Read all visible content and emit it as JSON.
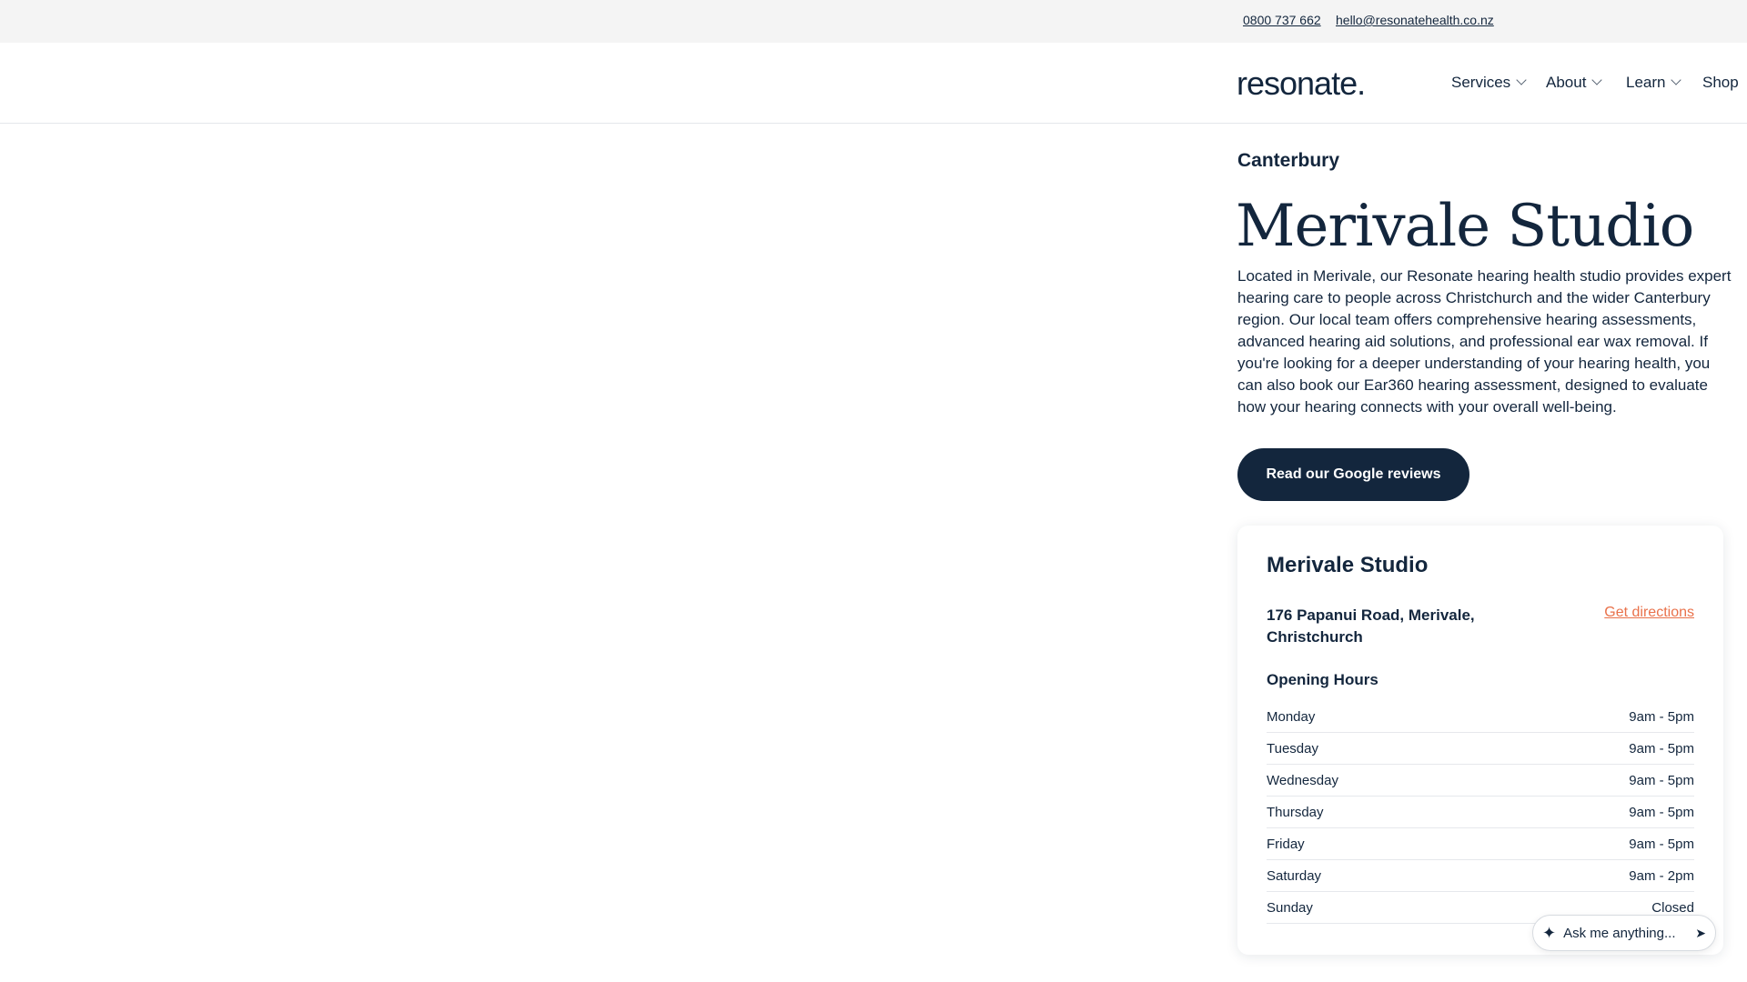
{
  "topbar": {
    "phone": "0800 737 662",
    "email": "hello@resonatehealth.co.nz"
  },
  "header": {
    "logo": "resonate.",
    "nav": [
      {
        "label": "Services"
      },
      {
        "label": "About"
      },
      {
        "label": "Learn"
      },
      {
        "label": "Shop"
      }
    ]
  },
  "main": {
    "region": "Canterbury",
    "title": "Merivale Studio",
    "intro": "Located in Merivale, our Resonate hearing health studio provides expert hearing care to people across Christchurch and the wider Canterbury region. Our local team offers comprehensive hearing assessments, advanced hearing aid solutions, and professional ear wax removal. If you're looking for a deeper understanding of your hearing health, you can also book our Ear360 hearing assessment, designed to evaluate how your hearing connects with your overall well-being.",
    "reviews_button": "Read our Google reviews"
  },
  "card": {
    "title": "Merivale Studio",
    "address": "176 Papanui Road, Merivale, Christchurch",
    "directions": "Get directions",
    "hours_title": "Opening Hours",
    "hours": [
      {
        "day": "Monday",
        "time": "9am - 5pm"
      },
      {
        "day": "Tuesday",
        "time": "9am - 5pm"
      },
      {
        "day": "Wednesday",
        "time": "9am - 5pm"
      },
      {
        "day": "Thursday",
        "time": "9am - 5pm"
      },
      {
        "day": "Friday",
        "time": "9am - 5pm"
      },
      {
        "day": "Saturday",
        "time": "9am - 2pm"
      },
      {
        "day": "Sunday",
        "time": "Closed"
      }
    ]
  },
  "assistant": {
    "placeholder": "Ask me anything...",
    "icons": [
      "sparkle-icon",
      "send-icon"
    ]
  },
  "colors": {
    "navy": "#13263d",
    "accent": "#e9714a",
    "topbar_bg": "#f4f4f4"
  }
}
